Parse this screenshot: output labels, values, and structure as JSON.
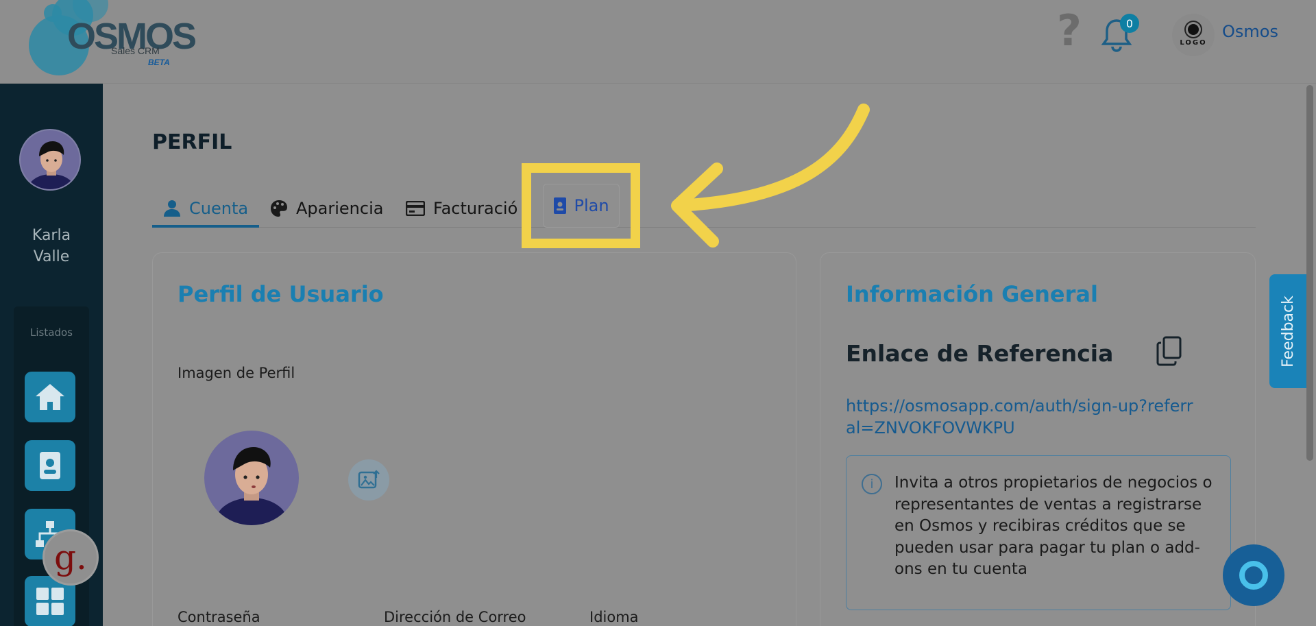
{
  "header": {
    "logo_text": "OSMOS",
    "logo_subtitle": "Sales CRM",
    "logo_badge": "BETA",
    "help_symbol": "?",
    "notification_count": "0",
    "company_logo_text": "LOGO",
    "company_name": "Osmos"
  },
  "sidebar": {
    "user_name": "Karla Valle",
    "section_label": "Listados",
    "items": [
      {
        "icon": "home-icon"
      },
      {
        "icon": "contact-card-icon"
      },
      {
        "icon": "sitemap-icon"
      },
      {
        "icon": "grid-icon"
      }
    ],
    "extension_letter": "g."
  },
  "page": {
    "title": "PERFIL",
    "tabs": [
      {
        "label": "Cuenta",
        "icon": "user-icon",
        "active": true
      },
      {
        "label": "Apariencia",
        "icon": "palette-icon"
      },
      {
        "label": "Facturació",
        "icon": "credit-card-icon"
      },
      {
        "label": "Plan",
        "icon": "id-badge-icon"
      }
    ]
  },
  "profile_card": {
    "title": "Perfil de Usuario",
    "image_label": "Imagen de Perfil",
    "fields": [
      "Contraseña",
      "Dirección de Correo",
      "Idioma"
    ]
  },
  "general_card": {
    "title": "Información General",
    "referral_title": "Enlace de Referencia",
    "referral_link": "https://osmosapp.com/auth/sign-up?referral=ZNVOKFOVWKPU",
    "info_symbol": "i",
    "info_text": "Invita a otros propietarios de negocios o representantes de ventas a registrarse en Osmos y recibiras créditos que se pueden usar para pagar tu plan o add-ons en tu cuenta"
  },
  "feedback_label": "Feedback",
  "colors": {
    "highlight": "#f2d24a",
    "accent": "#1a7fb1",
    "sidebar": "#0c2430"
  }
}
